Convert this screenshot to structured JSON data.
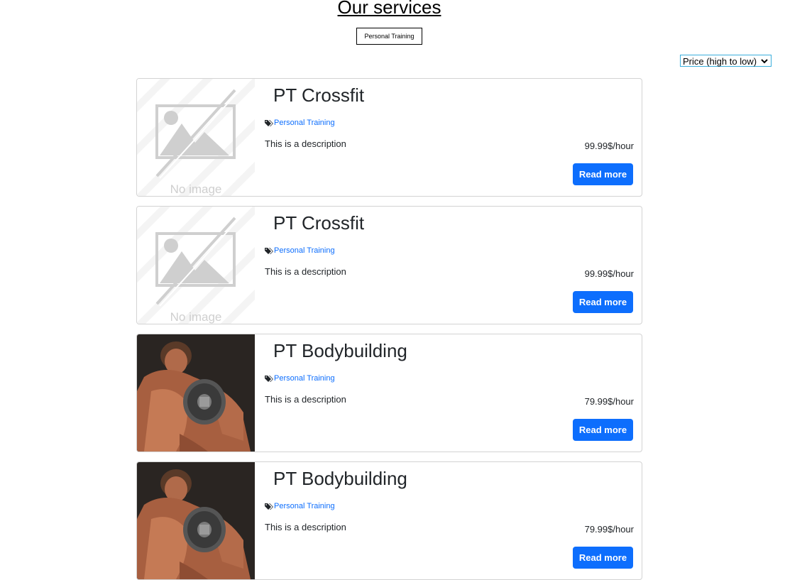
{
  "header": {
    "title": "Our services",
    "filter_chip": "Personal Training"
  },
  "sort": {
    "selected": "Price (high to low)"
  },
  "services": [
    {
      "title": "PT Crossfit",
      "tag": "Personal Training",
      "description": "This is a description",
      "price": "99.99$/hour",
      "button": "Read more",
      "image": "no-image-placeholder",
      "image_text": "No image"
    },
    {
      "title": "PT Crossfit",
      "tag": "Personal Training",
      "description": "This is a description",
      "price": "99.99$/hour",
      "button": "Read more",
      "image": "no-image-placeholder",
      "image_text": "No image"
    },
    {
      "title": "PT Bodybuilding",
      "tag": "Personal Training",
      "description": "This is a description",
      "price": "79.99$/hour",
      "button": "Read more",
      "image": "bodybuilder-dumbbell-photo"
    },
    {
      "title": "PT Bodybuilding",
      "tag": "Personal Training",
      "description": "This is a description",
      "price": "79.99$/hour",
      "button": "Read more",
      "image": "bodybuilder-dumbbell-photo"
    }
  ],
  "colors": {
    "primary": "#0d6efd",
    "border": "#d3d3d3",
    "select_border": "#3aaedc"
  }
}
